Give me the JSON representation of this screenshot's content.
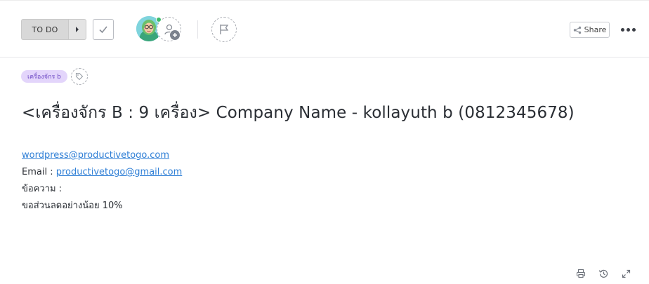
{
  "toolbar": {
    "status_label": "TO DO",
    "share_label": "Share",
    "colors": {
      "status_bg": "#d8d8d8",
      "online": "#3dbb6a"
    }
  },
  "icons": {
    "next_status": "caret-right-icon",
    "complete": "checkmark-icon",
    "assignee": "avatar",
    "add_assignee": "user-plus-icon",
    "priority": "flag-icon",
    "share": "share-icon",
    "more": "ellipsis-icon",
    "add_tag": "tag-icon",
    "print": "print-icon",
    "history": "history-icon",
    "expand": "expand-icon"
  },
  "tag": {
    "label": "เครื่องจักร b",
    "color": "#e3d5fb",
    "text_color": "#6a44c2"
  },
  "task": {
    "title": "<เครื่องจักร B : 9 เครื่อง> Company Name - kollayuth b (0812345678)"
  },
  "description": {
    "link_site": "wordpress@productivetogo.com",
    "email_label": "Email : ",
    "email_value": "productivetogo@gmail.com",
    "message_label": "ข้อความ :",
    "message_text": "ขอส่วนลดอย่างน้อย 10%"
  }
}
